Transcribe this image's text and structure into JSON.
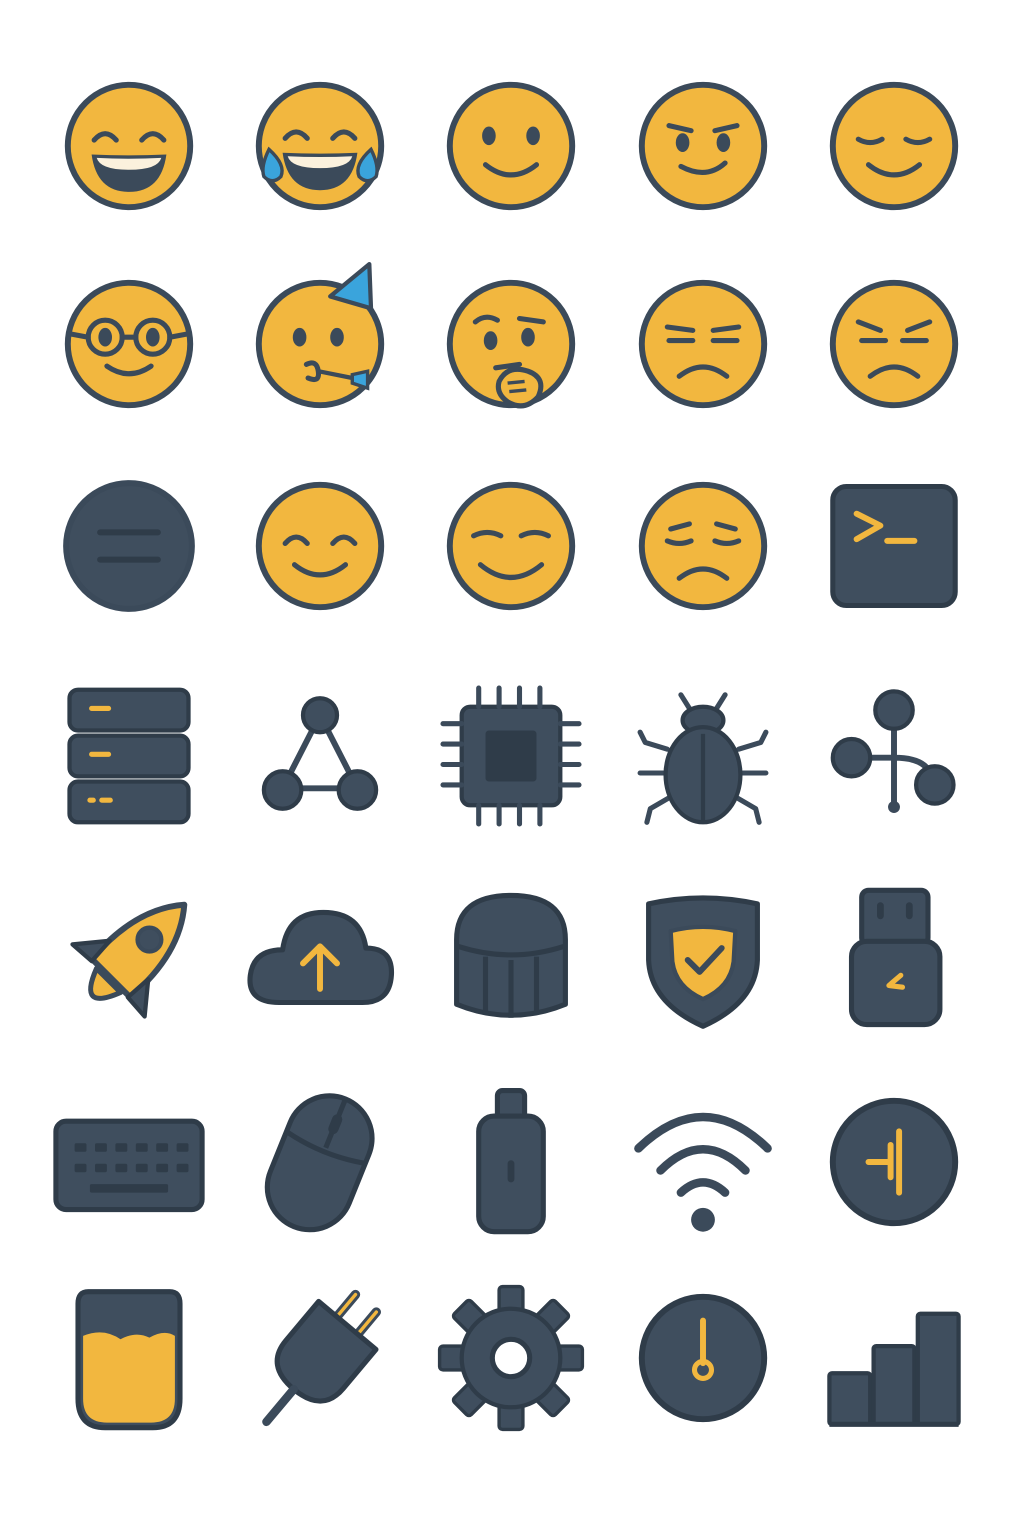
{
  "palette": {
    "yellow": "#f2b73f",
    "ink": "#3b4a5a",
    "dark": "#3f4e5e",
    "blue": "#3aa4dc",
    "white": "#ffffff",
    "teeth": "#fbf1dd"
  },
  "icons": [
    [
      "grinning-face-icon",
      "tears-of-joy-face-icon",
      "smiling-face-icon",
      "smirking-face-icon",
      "relieved-face-icon"
    ],
    [
      "nerd-face-icon",
      "partying-face-icon",
      "thinking-face-icon",
      "unamused-face-icon",
      "frowning-face-icon"
    ],
    [
      "minus-circle-icon",
      "happy-face-icon",
      "blushing-face-icon",
      "sad-face-icon",
      "terminal-icon"
    ],
    [
      "server-stack-icon",
      "network-nodes-icon",
      "cpu-chip-icon",
      "bug-icon",
      "git-branch-icon"
    ],
    [
      "rocket-icon",
      "cloud-upload-icon",
      "database-drum-icon",
      "security-shield-icon",
      "usb-drive-icon"
    ],
    [
      "keyboard-icon",
      "computer-mouse-icon",
      "usb-stick-icon",
      "wifi-signal-icon",
      "power-button-icon"
    ],
    [
      "battery-level-icon",
      "power-plug-icon",
      "gear-icon",
      "speedometer-gauge-icon",
      "bar-chart-icon"
    ]
  ]
}
